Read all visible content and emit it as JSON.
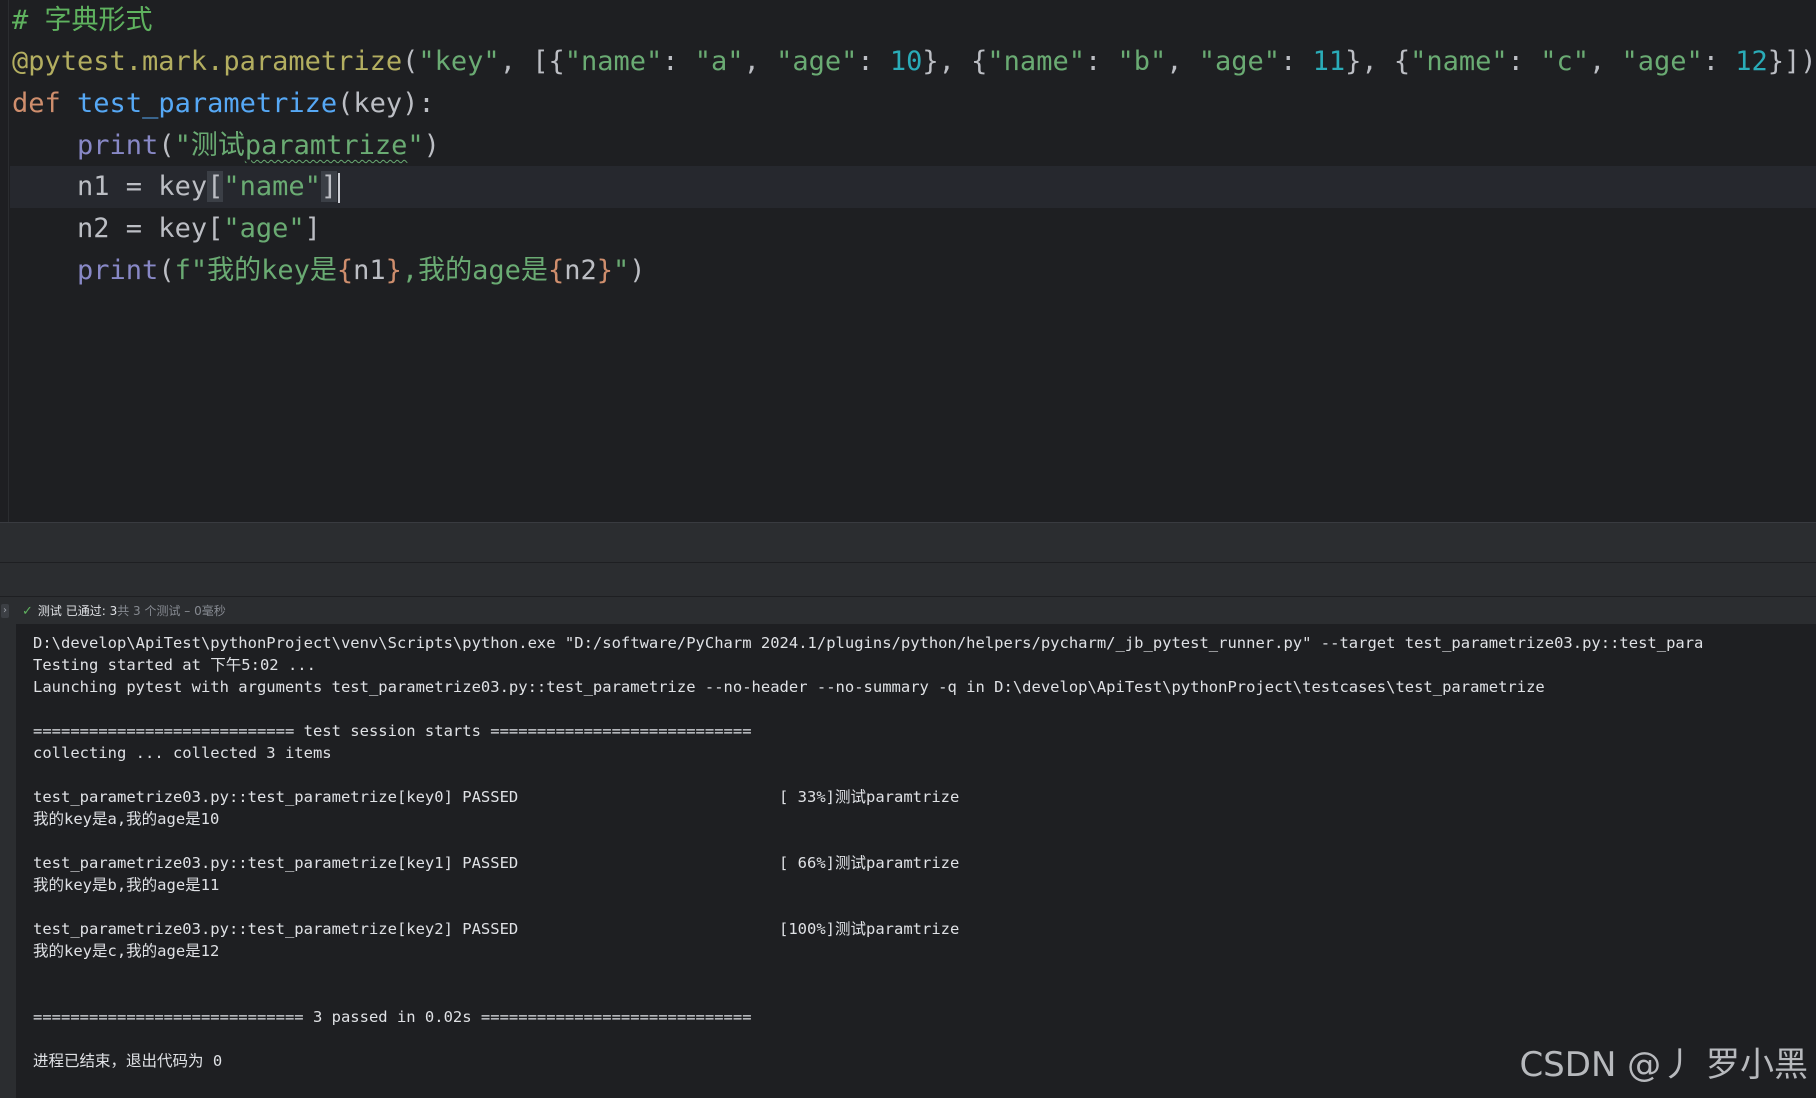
{
  "editor": {
    "comment": "# 字典形式",
    "decorator": "@pytest.mark.parametrize",
    "param_name": "\"key\"",
    "values": [
      {
        "k1": "\"name\"",
        "v1": "\"a\"",
        "k2": "\"age\"",
        "v2": "10"
      },
      {
        "k1": "\"name\"",
        "v1": "\"b\"",
        "k2": "\"age\"",
        "v2": "11"
      },
      {
        "k1": "\"name\"",
        "v1": "\"c\"",
        "k2": "\"age\"",
        "v2": "12"
      }
    ],
    "def_kw": "def",
    "func_name": "test_parametrize",
    "func_args": "(key):",
    "print_kw": "print",
    "print1_str_prefix": "\"测试",
    "print1_str_word": "paramtrize",
    "print1_str_suffix": "\"",
    "n1_assign": "n1 = key",
    "n1_key": "\"name\"",
    "n2_assign": "n2 = key",
    "n2_key": "\"age\"",
    "fstring_prefix": "f\"我的key是",
    "fstring_var1": "n1",
    "fstring_mid": ",我的age是",
    "fstring_var2": "n2",
    "fstring_end": "\""
  },
  "test_status": {
    "label": "测试 已通过: 3",
    "detail": "共 3 个测试 – 0毫秒"
  },
  "console": {
    "lines": [
      "D:\\develop\\ApiTest\\pythonProject\\venv\\Scripts\\python.exe \"D:/software/PyCharm 2024.1/plugins/python/helpers/pycharm/_jb_pytest_runner.py\" --target test_parametrize03.py::test_para",
      "Testing started at 下午5:02 ...",
      "Launching pytest with arguments test_parametrize03.py::test_parametrize --no-header --no-summary -q in D:\\develop\\ApiTest\\pythonProject\\testcases\\test_parametrize",
      "============================ test session starts ============================",
      "collecting ... collected 3 items"
    ],
    "results": [
      {
        "test": "test_parametrize03.py::test_parametrize[key0] PASSED",
        "progress": "[ 33%]测试paramtrize",
        "output": "我的key是a,我的age是10"
      },
      {
        "test": "test_parametrize03.py::test_parametrize[key1] PASSED",
        "progress": "[ 66%]测试paramtrize",
        "output": "我的key是b,我的age是11"
      },
      {
        "test": "test_parametrize03.py::test_parametrize[key2] PASSED",
        "progress": "[100%]测试paramtrize",
        "output": "我的key是c,我的age是12"
      }
    ],
    "summary": "============================= 3 passed in 0.02s =============================",
    "exit": "进程已结束，退出代码为 0"
  },
  "watermark": "CSDN @丿 罗小黑"
}
